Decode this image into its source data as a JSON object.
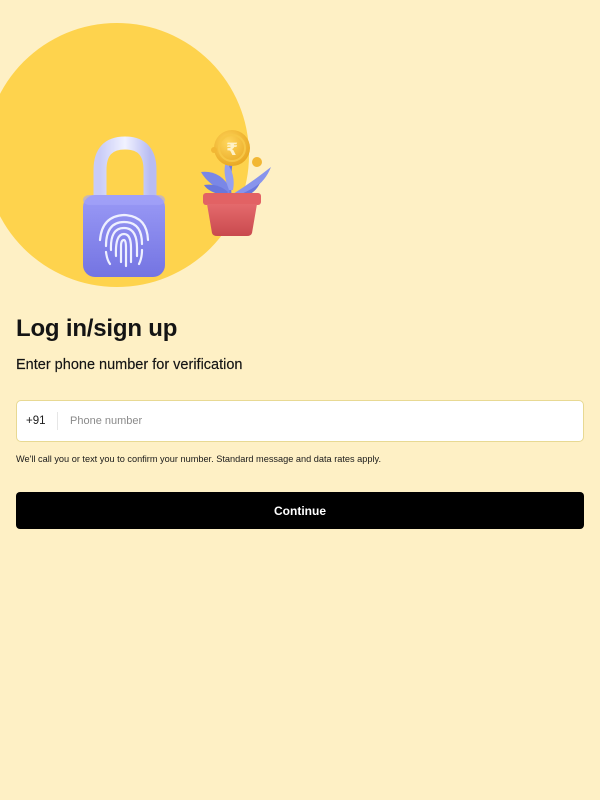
{
  "hero": {
    "currency_symbol": "₹",
    "colors": {
      "background": "#FEF0C5",
      "circle": "#FED34D",
      "lock_body": "#8C8CF2",
      "pot": "#D9575A",
      "leaves": "#7A87E6",
      "coin": "#F2B734"
    }
  },
  "heading": {
    "title": "Log in/sign up",
    "subtitle": "Enter phone number for verification"
  },
  "phone": {
    "country_code": "+91",
    "placeholder": "Phone number",
    "value": ""
  },
  "disclaimer": "We'll call you or text you to confirm your number. Standard message and data rates apply.",
  "continue_label": "Continue"
}
